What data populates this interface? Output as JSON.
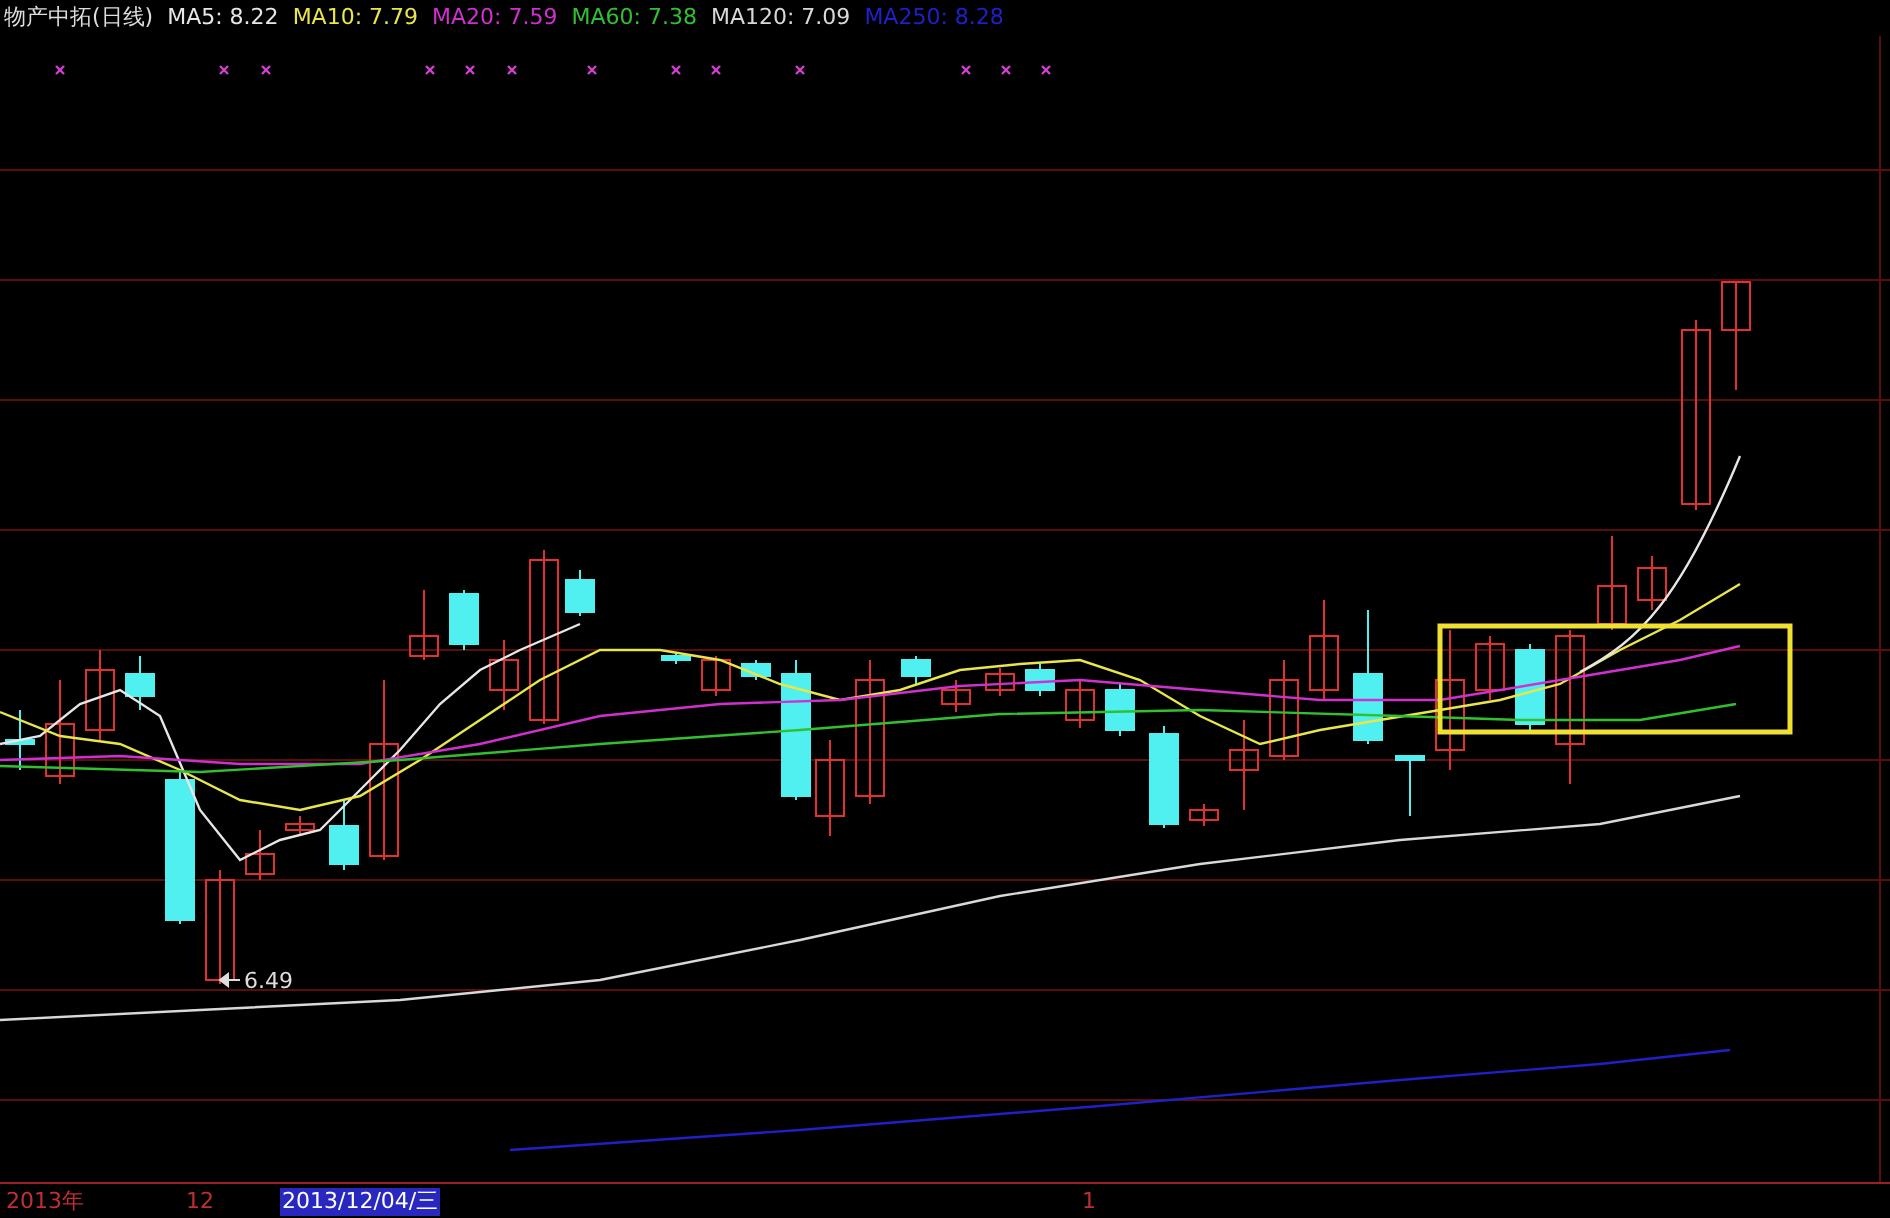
{
  "legend": {
    "title": "物产中拓(日线)",
    "indicators": [
      {
        "label": "MA5: 8.22",
        "color": "#e6e6e6"
      },
      {
        "label": "MA10: 7.79",
        "color": "#e8e64a"
      },
      {
        "label": "MA20: 7.59",
        "color": "#d030d0"
      },
      {
        "label": "MA60: 7.38",
        "color": "#30c030"
      },
      {
        "label": "MA120: 7.09",
        "color": "#d8d8d8"
      },
      {
        "label": "MA250: 8.28",
        "color": "#2020c8"
      }
    ]
  },
  "chart": {
    "low_label": "6.49"
  },
  "time_axis": [
    {
      "label": "2013年",
      "selected": false
    },
    {
      "label": "12",
      "selected": false
    },
    {
      "label": "2013/12/04/三",
      "selected": true
    },
    {
      "label": "1",
      "selected": false
    }
  ]
}
